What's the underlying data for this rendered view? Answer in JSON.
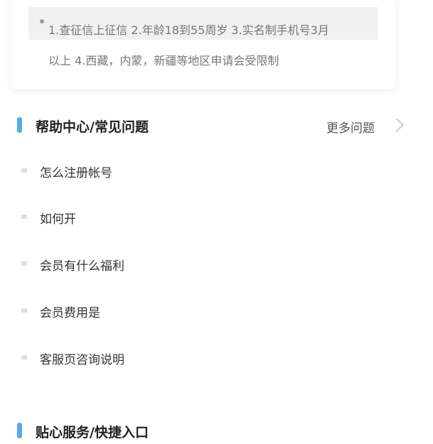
{
  "notice": {
    "line1": "1.查征信上征信 2.年龄18到55周岁 3.实名制手机号3月",
    "line2": "以上 4.西藏，内蒙，新疆等地区申请会受限制"
  },
  "help_section": {
    "title": "帮助中心/常见问题",
    "more_label": "更多问题",
    "items": [
      "怎么注册帐号",
      "如何开",
      "会员有什么福利",
      "会员费用是",
      "客服页咨询说明"
    ]
  },
  "quick_section": {
    "title": "贴心服务/快捷入口"
  },
  "colors": {
    "accent": "#5aa9f0"
  }
}
